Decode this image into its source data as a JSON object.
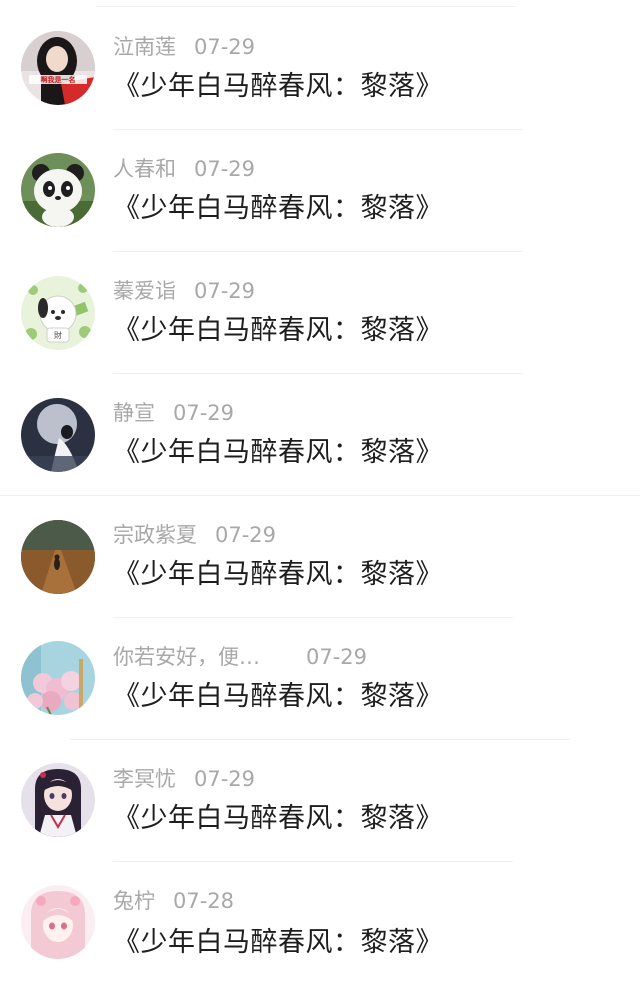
{
  "comments": [
    {
      "user": "泣南莲",
      "date": "07-29",
      "title": "《少年白马醉春风：黎落》",
      "avatar_icon": "girl-red-portrait",
      "avatar_badge": "啊我是一名"
    },
    {
      "user": "人春和",
      "date": "07-29",
      "title": "《少年白马醉春风：黎落》",
      "avatar_icon": "panda"
    },
    {
      "user": "蓁爱诣",
      "date": "07-29",
      "title": "《少年白马醉春风：黎落》",
      "avatar_icon": "pochacco-dog"
    },
    {
      "user": "静宣",
      "date": "07-29",
      "title": "《少年白马醉春风：黎落》",
      "avatar_icon": "moon-girl"
    },
    {
      "user": "宗政紫夏",
      "date": "07-29",
      "title": "《少年白马醉春风：黎落》",
      "avatar_icon": "road-sunset"
    },
    {
      "user": "你若安好，便…",
      "date": "07-29",
      "title": "《少年白马醉春风：黎落》",
      "avatar_icon": "lilac-flowers"
    },
    {
      "user": "李冥忧",
      "date": "07-29",
      "title": "《少年白马醉春风：黎落》",
      "avatar_icon": "anime-hanfu-girl"
    },
    {
      "user": "兔柠",
      "date": "07-28",
      "title": "《少年白马醉春风：黎落》",
      "avatar_icon": "pink-anime-girl"
    }
  ]
}
